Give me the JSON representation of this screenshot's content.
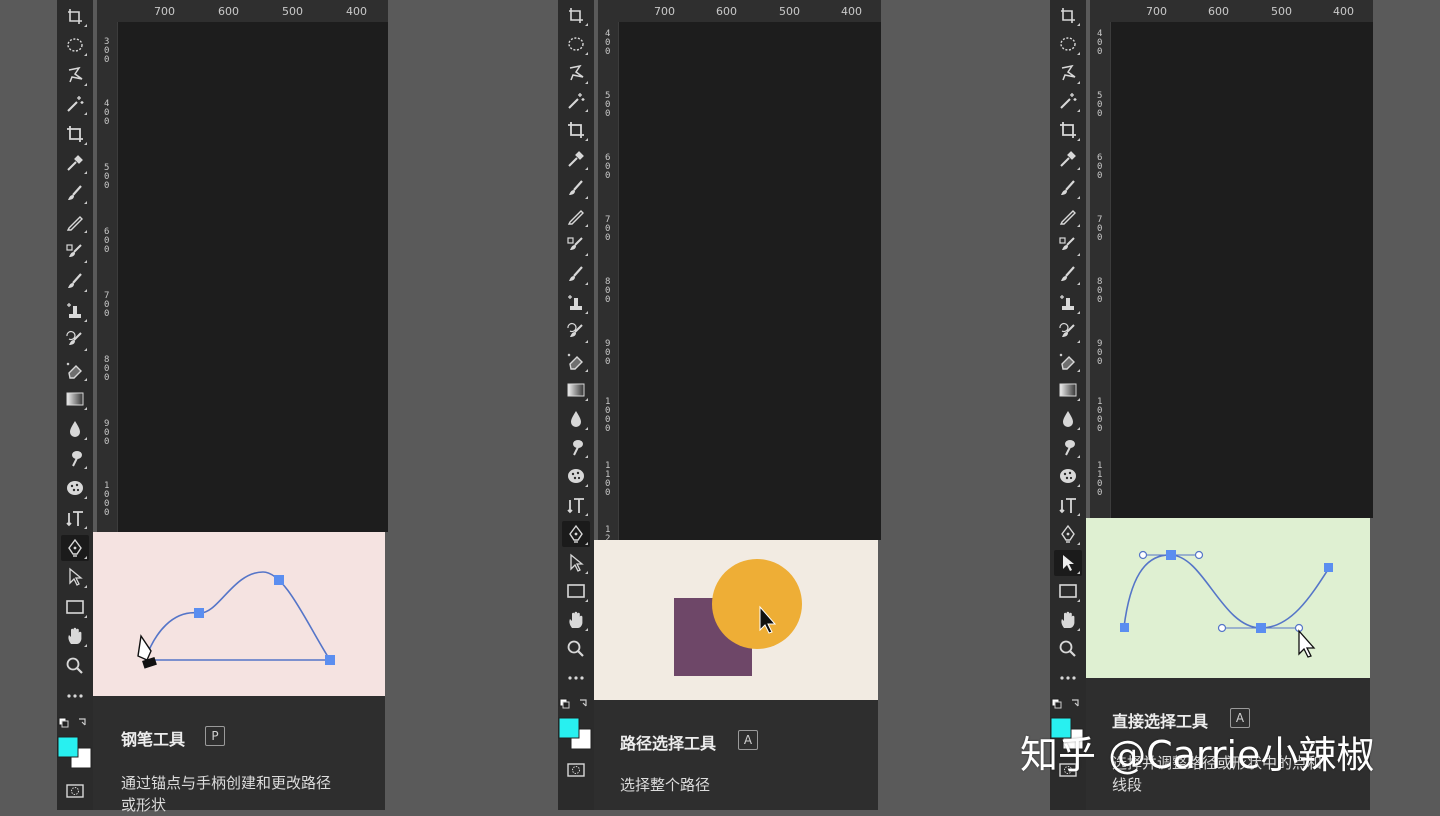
{
  "panels": [
    {
      "ruler_top_ticks": [
        "700",
        "600",
        "500",
        "400"
      ],
      "ruler_left_ticks": [
        "300",
        "400",
        "500",
        "600",
        "700",
        "800",
        "900",
        "1000"
      ],
      "tooltip": {
        "title": "钢笔工具",
        "key": "P",
        "desc_line1": "通过锚点与手柄创建和更改路径",
        "desc_line2": "或形状"
      },
      "preview_bg": "#f5e3e1"
    },
    {
      "ruler_top_ticks": [
        "700",
        "600",
        "500",
        "400"
      ],
      "ruler_left_ticks": [
        "400",
        "500",
        "600",
        "700",
        "800",
        "900",
        "1000",
        "1100",
        "12"
      ],
      "tooltip": {
        "title": "路径选择工具",
        "key": "A",
        "desc_line1": "选择整个路径",
        "desc_line2": ""
      },
      "preview_bg": "#f2ebe2"
    },
    {
      "ruler_top_ticks": [
        "700",
        "600",
        "500",
        "400"
      ],
      "ruler_left_ticks": [
        "400",
        "500",
        "600",
        "700",
        "800",
        "900",
        "1000",
        "1100"
      ],
      "tooltip": {
        "title": "直接选择工具",
        "key": "A",
        "desc_line1": "选择并调整路径或形状中的点和",
        "desc_line2": "线段"
      },
      "preview_bg": "#dff0d2"
    }
  ],
  "colors": {
    "accent_blue": "#5b8ef0",
    "path_line": "#5575c8",
    "foreground_swatch": "#28f0f0",
    "background_swatch": "#ffffff",
    "shape_square": "#6e4768",
    "shape_circle": "#eeae36"
  },
  "watermark": "知乎 @Carrie小辣椒"
}
